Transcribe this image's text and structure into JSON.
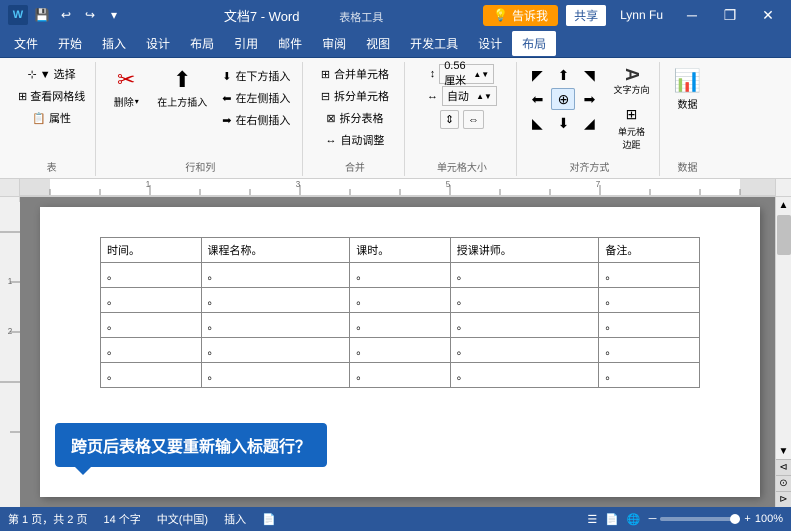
{
  "titlebar": {
    "title": "文档7 - Word",
    "tab_title": "Word",
    "user": "Lynn Fu",
    "save_label": "💾",
    "undo_label": "↩",
    "redo_label": "↪",
    "minimize": "─",
    "restore": "❐",
    "close": "✕",
    "share_label": "共享",
    "help_label": "告诉我"
  },
  "menubar": {
    "items": [
      "文件",
      "开始",
      "插入",
      "设计",
      "布局",
      "引用",
      "邮件",
      "审阅",
      "视图",
      "开发工具",
      "设计",
      "布局"
    ]
  },
  "ribbon": {
    "groups": {
      "table": {
        "label": "表",
        "select_label": "▼ 选择",
        "gridlines_label": "查看网格线",
        "properties_label": "属性"
      },
      "rowcol": {
        "label": "行和列",
        "delete_label": "删除",
        "insert_above_label": "在上方插入",
        "insert_below_label": "在下方插入",
        "insert_left_label": "在左侧插入",
        "insert_right_label": "在右侧插入"
      },
      "merge": {
        "label": "合并",
        "merge_cells_label": "合并单元格",
        "split_cells_label": "拆分单元格",
        "split_table_label": "拆分表格",
        "auto_fit_label": "自动调整"
      },
      "cellsize": {
        "label": "单元格大小",
        "height_label": "0.56 厘米",
        "width_label": "自动",
        "height_icon": "↕",
        "width_icon": "↔"
      },
      "alignment": {
        "label": "对齐方式",
        "text_dir_label": "文字方向",
        "cell_margin_label": "单元格\n边距",
        "buttons": [
          "◸◿",
          "⬛⬜",
          "↙",
          "☰",
          "⬜⬛",
          "↗",
          "↙",
          "⬜⬜",
          "↘"
        ]
      },
      "data": {
        "label": "数据",
        "data_label": "数据"
      }
    }
  },
  "document": {
    "table": {
      "headers": [
        "时间。",
        "课程名称。",
        "课时。",
        "授课讲师。",
        "备注。"
      ],
      "rows": [
        [
          "。",
          "。",
          "。",
          "。",
          "。"
        ],
        [
          "。",
          "。",
          "。",
          "。",
          "。"
        ],
        [
          "。",
          "。",
          "。",
          "。",
          "。"
        ],
        [
          "。",
          "。",
          "。",
          "。",
          "。"
        ],
        [
          "。",
          "。",
          "。",
          "。",
          "。"
        ]
      ]
    },
    "tooltip": "跨页后表格又要重新输入标题行？"
  },
  "statusbar": {
    "page_info": "第 1 页，共 2 页",
    "word_count": "14 个字",
    "language": "中文(中国)",
    "mode": "插入",
    "file_icon": "📄",
    "zoom_pct": "100%",
    "view_icons": [
      "☰",
      "📄",
      "📋",
      "📊",
      "🌐"
    ]
  }
}
